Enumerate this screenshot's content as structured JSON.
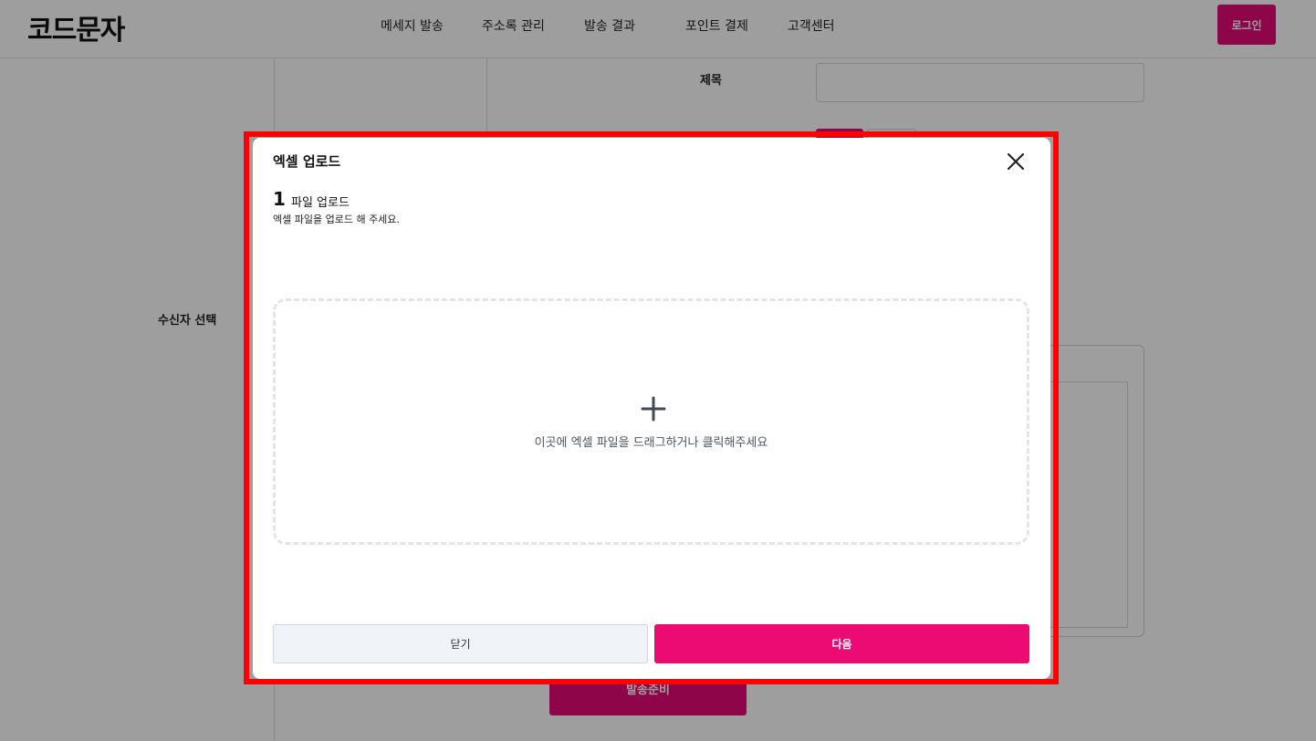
{
  "header": {
    "logo": "코드문자",
    "nav": [
      "메세지 발송",
      "주소록 관리",
      "발송 결과",
      "포인트 결제",
      "고객센터"
    ],
    "login_label": "로그인"
  },
  "form": {
    "subject_label": "제목",
    "recipient_label": "수신자 선택",
    "send_ready_label": "발송준비"
  },
  "modal": {
    "title": "엑셀 업로드",
    "step": {
      "number": "1",
      "title": "파일 업로드",
      "description": "엑셀 파일을 업로드 해 주세요."
    },
    "dropzone_text": "이곳에 엑셀 파일을 드래그하거나 클릭해주세요",
    "close_label": "닫기",
    "next_label": "다음"
  },
  "colors": {
    "brand": "#ec0a73",
    "highlight": "#ff0000"
  },
  "icons": {
    "close": "close-icon",
    "add": "plus-icon"
  }
}
